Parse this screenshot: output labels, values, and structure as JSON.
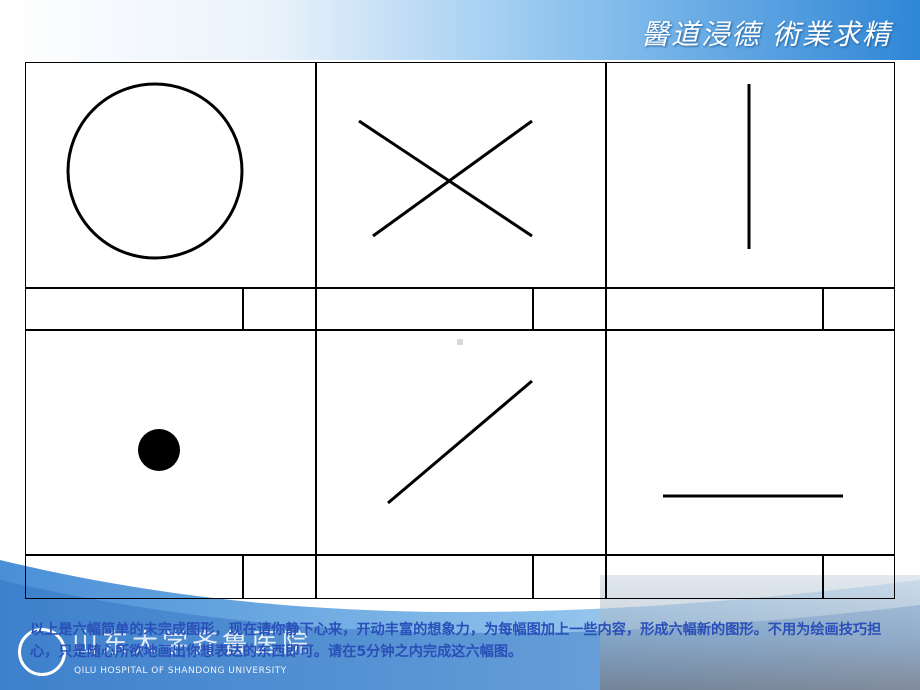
{
  "header": {
    "motto": "醫道浸德 術業求精"
  },
  "footer_brand": {
    "name": "山东大学齐鲁医院",
    "subtitle": "QILU HOSPITAL OF SHANDONG UNIVERSITY"
  },
  "instruction": {
    "text": "以上是六幅简单的未完成图形，现在请你静下心来，开动丰富的想象力，为每幅图加上一些内容，形成六幅新的图形。不用为绘画技巧担心，只是随心所欲地画出你想表达的东西即可。请在5分钟之内完成这六幅图。"
  },
  "panels": [
    {
      "shape": "circle-outline-icon",
      "title_value": "",
      "number_value": ""
    },
    {
      "shape": "x-cross-icon",
      "title_value": "",
      "number_value": ""
    },
    {
      "shape": "vertical-line-icon",
      "title_value": "",
      "number_value": ""
    },
    {
      "shape": "filled-dot-icon",
      "title_value": "",
      "number_value": ""
    },
    {
      "shape": "diagonal-line-icon",
      "title_value": "",
      "number_value": ""
    },
    {
      "shape": "horizontal-line-icon",
      "title_value": "",
      "number_value": ""
    }
  ],
  "colors": {
    "header_blue": "#2f86d6",
    "instruction_text": "#2a4fb8",
    "line": "#000000"
  }
}
